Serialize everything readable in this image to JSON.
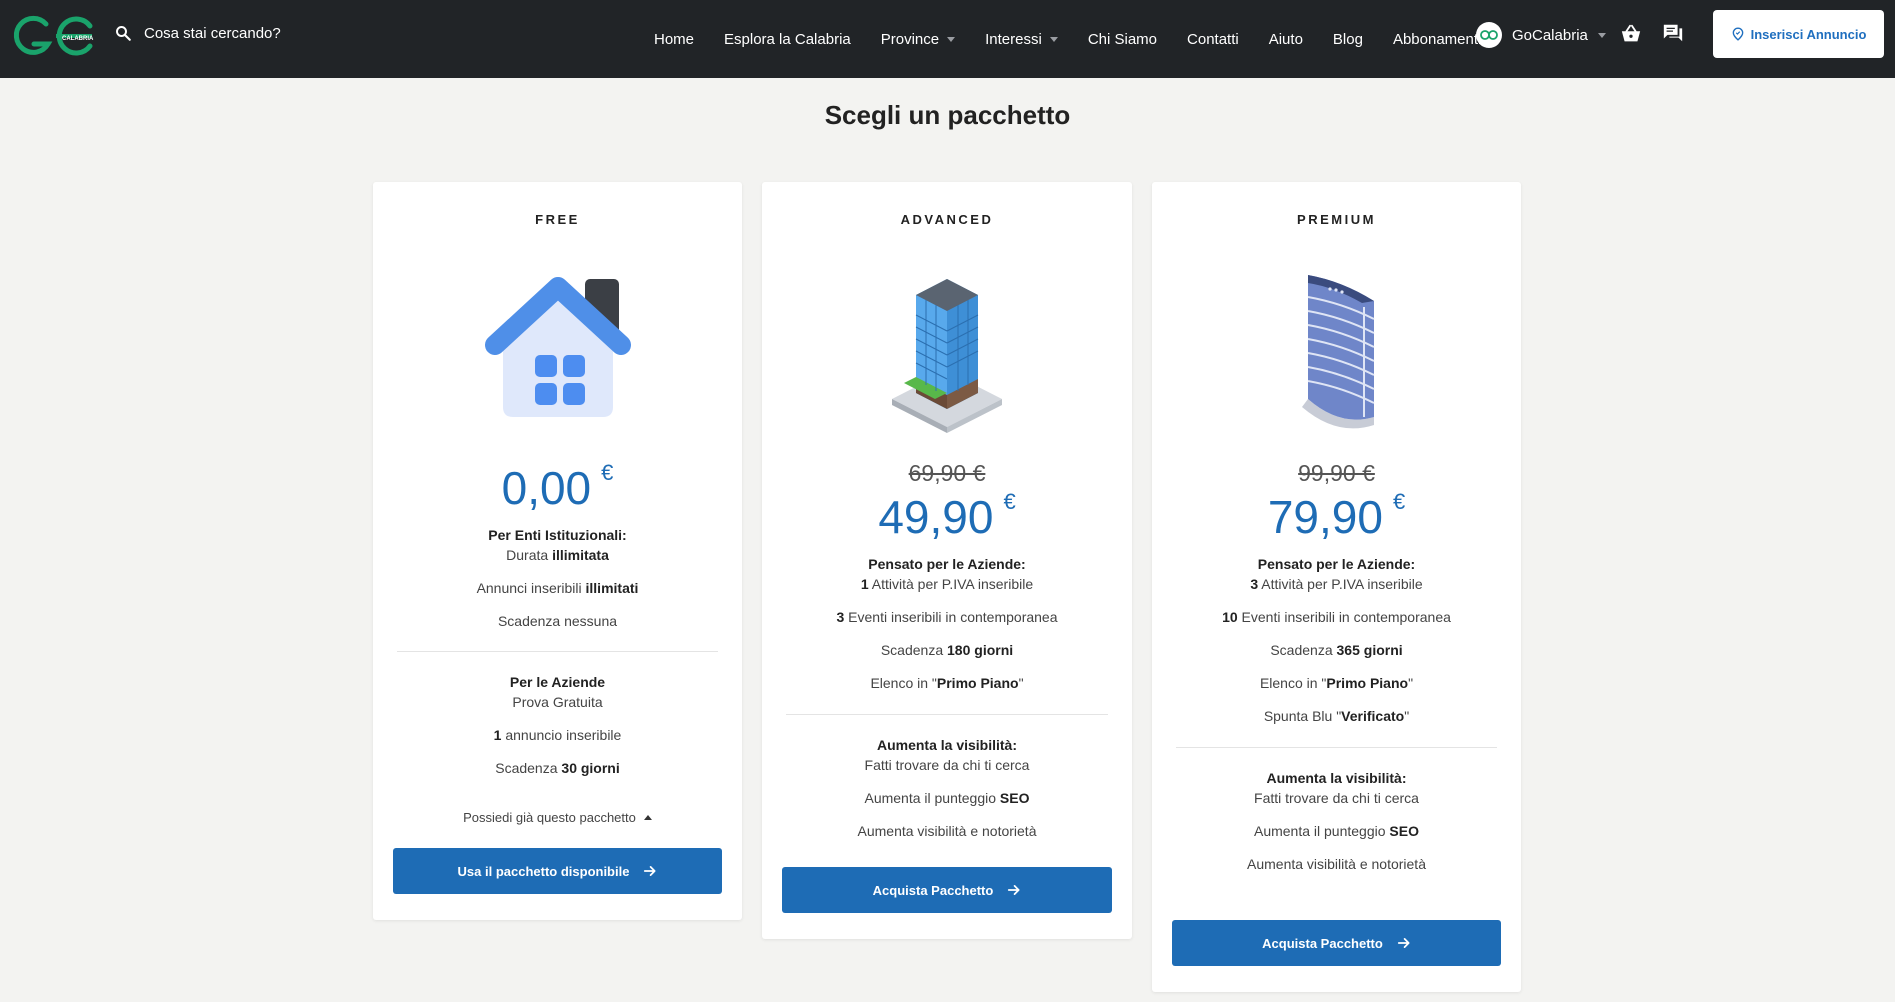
{
  "nav": {
    "logo_text": "CALABRIA",
    "search_placeholder": "Cosa stai cercando?",
    "items": [
      {
        "label": "Home",
        "dropdown": false
      },
      {
        "label": "Esplora la Calabria",
        "dropdown": false
      },
      {
        "label": "Province",
        "dropdown": true
      },
      {
        "label": "Interessi",
        "dropdown": true
      },
      {
        "label": "Chi Siamo",
        "dropdown": false
      },
      {
        "label": "Contatti",
        "dropdown": false
      },
      {
        "label": "Aiuto",
        "dropdown": false
      },
      {
        "label": "Blog",
        "dropdown": false
      },
      {
        "label": "Abbonamenti",
        "dropdown": false
      }
    ],
    "user_name": "GoCalabria",
    "cta_label": "Inserisci Annuncio"
  },
  "page": {
    "title": "Scegli un pacchetto"
  },
  "colors": {
    "navbar": "#212427",
    "accent": "#1e6cb5",
    "logo_green": "#1aa36b"
  },
  "packages": [
    {
      "tier": "FREE",
      "price": "0,00",
      "currency": "€",
      "lines_a": [
        {
          "pre": "",
          "bold": "Per Enti Istituzionali:",
          "post": "",
          "type": "hd"
        },
        {
          "pre": "Durata ",
          "bold": "illimitata",
          "post": "",
          "type": "sub"
        },
        {
          "pre": "Annunci inseribili ",
          "bold": "illimitati",
          "post": ""
        },
        {
          "pre": "Scadenza nessuna",
          "bold": "",
          "post": ""
        }
      ],
      "lines_b": [
        {
          "pre": "",
          "bold": "Per le Aziende",
          "post": "",
          "type": "hd"
        },
        {
          "pre": "Prova Gratuita",
          "bold": "",
          "post": "",
          "type": "sub"
        },
        {
          "pre": "",
          "bold": "1",
          "post": " annuncio inseribile"
        },
        {
          "pre": "Scadenza ",
          "bold": "30 giorni",
          "post": ""
        }
      ],
      "owned_label": "Possiedi già questo pacchetto",
      "button": "Usa il pacchetto disponibile"
    },
    {
      "tier": "ADVANCED",
      "old_price": "69,90 €",
      "price": "49,90",
      "currency": "€",
      "lines_a": [
        {
          "pre": "",
          "bold": "Pensato per le Aziende:",
          "post": "",
          "type": "hd"
        },
        {
          "pre": "",
          "bold": "1",
          "post": " Attività per P.IVA inseribile",
          "type": "sub"
        },
        {
          "pre": "",
          "bold": "3",
          "post": " Eventi inseribili in contemporanea"
        },
        {
          "pre": "Scadenza ",
          "bold": "180 giorni",
          "post": ""
        },
        {
          "pre": "Elenco in \"",
          "bold": "Primo Piano",
          "post": "\""
        }
      ],
      "lines_b": [
        {
          "pre": "",
          "bold": "Aumenta la visibilità:",
          "post": "",
          "type": "hd"
        },
        {
          "pre": "Fatti trovare da chi ti cerca",
          "bold": "",
          "post": "",
          "type": "sub"
        },
        {
          "pre": "Aumenta il punteggio ",
          "bold": "SEO",
          "post": ""
        },
        {
          "pre": "Aumenta visibilità e notorietà",
          "bold": "",
          "post": ""
        }
      ],
      "button": "Acquista Pacchetto"
    },
    {
      "tier": "PREMIUM",
      "old_price": "99,90 €",
      "price": "79,90",
      "currency": "€",
      "lines_a": [
        {
          "pre": "",
          "bold": "Pensato per le Aziende:",
          "post": "",
          "type": "hd"
        },
        {
          "pre": "",
          "bold": "3",
          "post": " Attività per P.IVA inseribile",
          "type": "sub"
        },
        {
          "pre": "",
          "bold": "10",
          "post": " Eventi inseribili in contemporanea"
        },
        {
          "pre": "Scadenza ",
          "bold": "365 giorni",
          "post": ""
        },
        {
          "pre": "Elenco in \"",
          "bold": "Primo Piano",
          "post": "\""
        },
        {
          "pre": "Spunta Blu \"",
          "bold": "Verificato",
          "post": "\""
        }
      ],
      "lines_b": [
        {
          "pre": "",
          "bold": "Aumenta la visibilità:",
          "post": "",
          "type": "hd"
        },
        {
          "pre": "Fatti trovare da chi ti cerca",
          "bold": "",
          "post": "",
          "type": "sub"
        },
        {
          "pre": "Aumenta il punteggio ",
          "bold": "SEO",
          "post": ""
        },
        {
          "pre": "Aumenta visibilità e notorietà",
          "bold": "",
          "post": ""
        }
      ],
      "button": "Acquista Pacchetto"
    }
  ]
}
